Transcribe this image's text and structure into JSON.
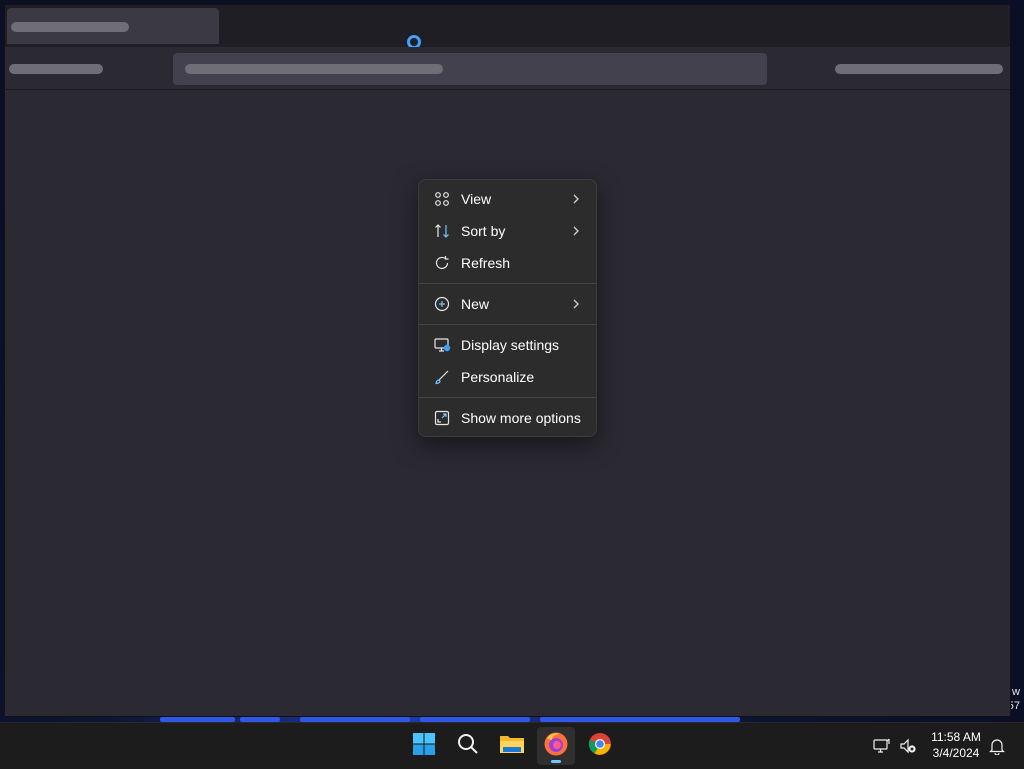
{
  "context_menu": {
    "items": [
      {
        "label": "View",
        "icon": "grid-icon",
        "submenu": true
      },
      {
        "label": "Sort by",
        "icon": "sort-icon",
        "submenu": true
      },
      {
        "label": "Refresh",
        "icon": "refresh-icon",
        "submenu": false
      },
      {
        "label": "New",
        "icon": "plus-circle-icon",
        "submenu": true
      },
      {
        "label": "Display settings",
        "icon": "display-settings-icon",
        "submenu": false
      },
      {
        "label": "Personalize",
        "icon": "brush-icon",
        "submenu": false
      },
      {
        "label": "Show more options",
        "icon": "expand-icon",
        "submenu": false
      }
    ]
  },
  "taskbar": {
    "apps": [
      "start-icon",
      "search-icon",
      "file-explorer-icon",
      "firefox-icon",
      "chrome-icon"
    ],
    "active_app": "firefox-icon",
    "clock": {
      "time": "11:58 AM",
      "date": "3/4/2024"
    }
  },
  "desktop": {
    "edge_text_1": "w",
    "edge_text_2": "57"
  },
  "colors": {
    "accent": "#3fa0ff",
    "menu_bg": "#2c2c2c",
    "window_bg": "#2b2a33",
    "taskbar_bg": "#1c1c1c"
  }
}
